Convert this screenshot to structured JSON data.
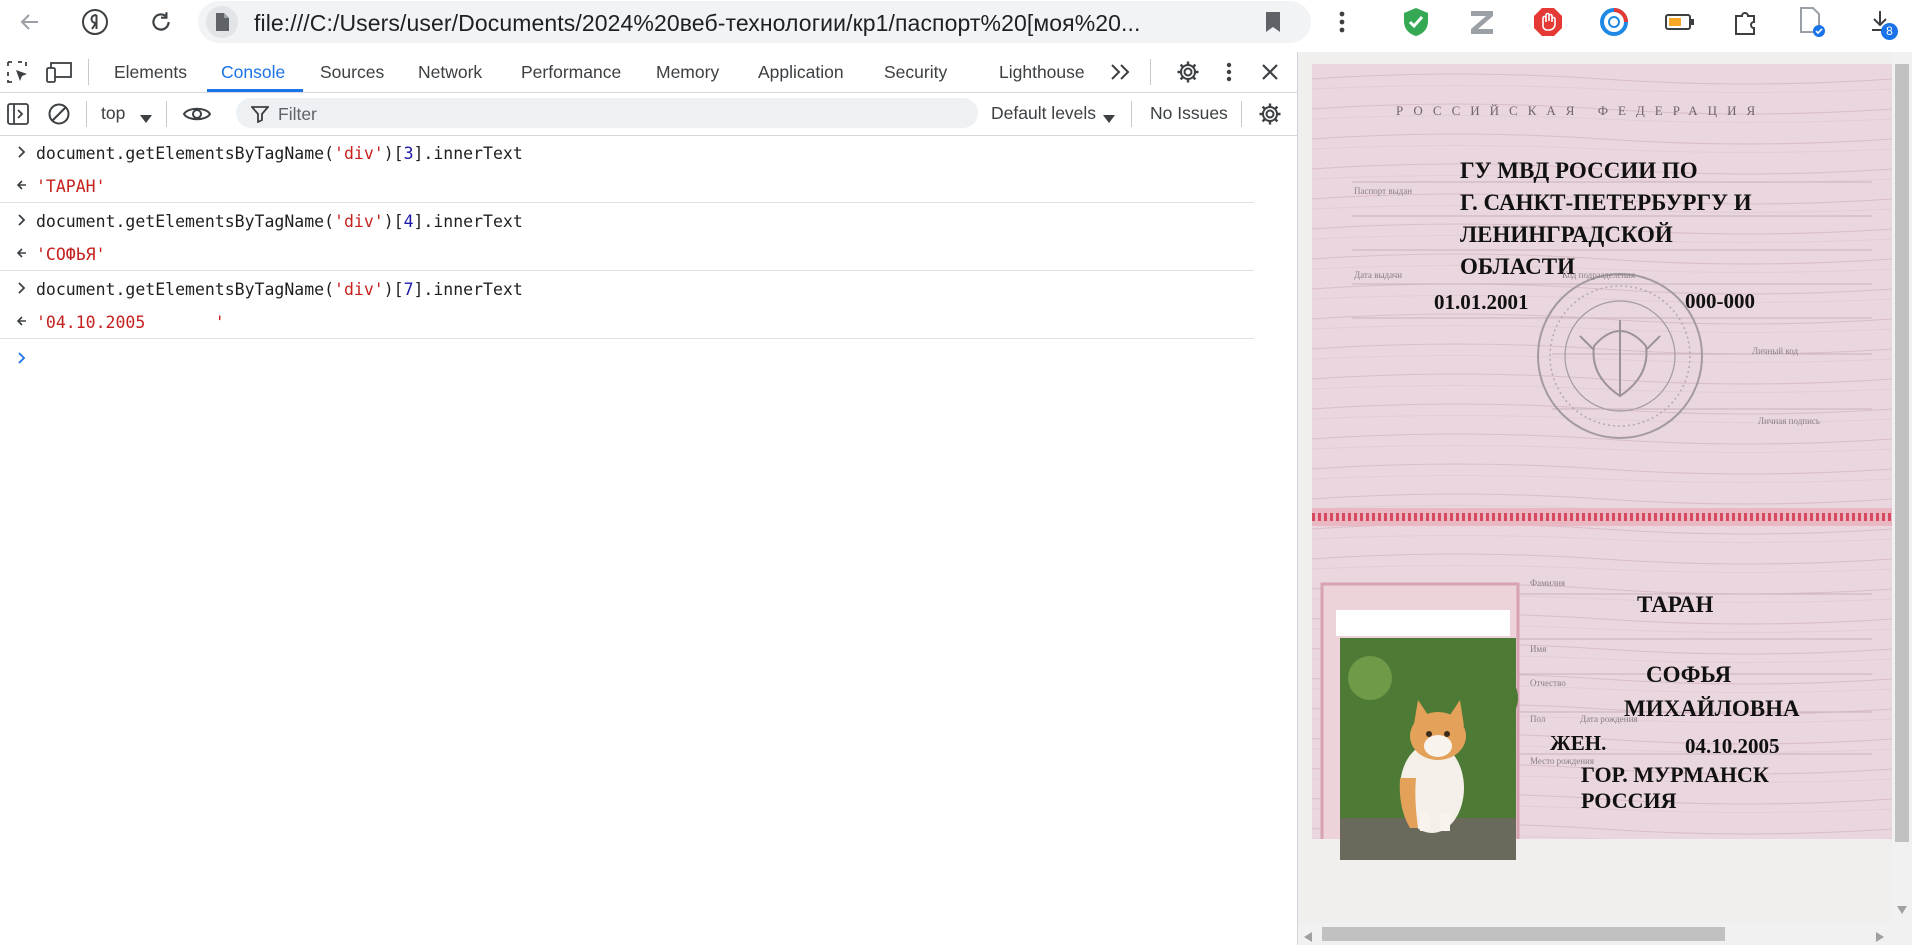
{
  "browser": {
    "url": "file:///C:/Users/user/Documents/2024%20веб-технологии/кр1/паспорт%20[моя%20...",
    "downloads_badge": "8"
  },
  "devtools": {
    "tabs": [
      "Elements",
      "Console",
      "Sources",
      "Network",
      "Performance",
      "Memory",
      "Application",
      "Security",
      "Lighthouse"
    ],
    "active_tab": "Console",
    "toolbar": {
      "context": "top",
      "filter_placeholder": "Filter",
      "levels": "Default levels",
      "issues": "No Issues"
    },
    "console": [
      {
        "input_prefix": "document.getElementsByTagName(",
        "input_arg": "'div'",
        "input_mid": ")[",
        "input_index": "3",
        "input_suffix": "].innerText",
        "result": "'ТАРАН'"
      },
      {
        "input_prefix": "document.getElementsByTagName(",
        "input_arg": "'div'",
        "input_mid": ")[",
        "input_index": "4",
        "input_suffix": "].innerText",
        "result": "'СОФЬЯ'"
      },
      {
        "input_prefix": "document.getElementsByTagName(",
        "input_arg": "'div'",
        "input_mid": ")[",
        "input_index": "7",
        "input_suffix": "].innerText",
        "result": "'04.10.2005       '"
      }
    ]
  },
  "passport": {
    "header": "РОССИЙСКАЯ ФЕДЕРАЦИЯ",
    "issued_by_lines": [
      "ГУ МВД РОССИИ ПО",
      "Г. САНКТ-ПЕТЕРБУРГУ И",
      "ЛЕНИНГРАДСКОЙ",
      "ОБЛАСТИ"
    ],
    "issue_date": "01.01.2001",
    "division_code": "000-000",
    "surname": "ТАРАН",
    "first_name": "СОФЬЯ",
    "patronymic": "МИХАЙЛОВНА",
    "sex": "ЖЕН.",
    "birth_date": "04.10.2005",
    "birthplace_lines": [
      "ГОР. МУРМАНСК",
      "РОССИЯ"
    ],
    "labels": {
      "issued_by": "Паспорт выдан",
      "issue_date": "Дата выдачи",
      "division_code": "Код подразделения",
      "personal_sign": "Личный код",
      "sign": "Личная подпись",
      "surname": "Фамилия",
      "name": "Имя",
      "patronymic": "Отчество",
      "sex": "Пол",
      "birth_date": "Дата рождения",
      "birthplace": "Место рождения"
    }
  },
  "colors": {
    "accent": "#1a73e8",
    "console_string": "#c5221f",
    "console_number": "#1a1aa6",
    "passport_bg": "#ead5dd",
    "passport_stripe": "#d7495f"
  }
}
